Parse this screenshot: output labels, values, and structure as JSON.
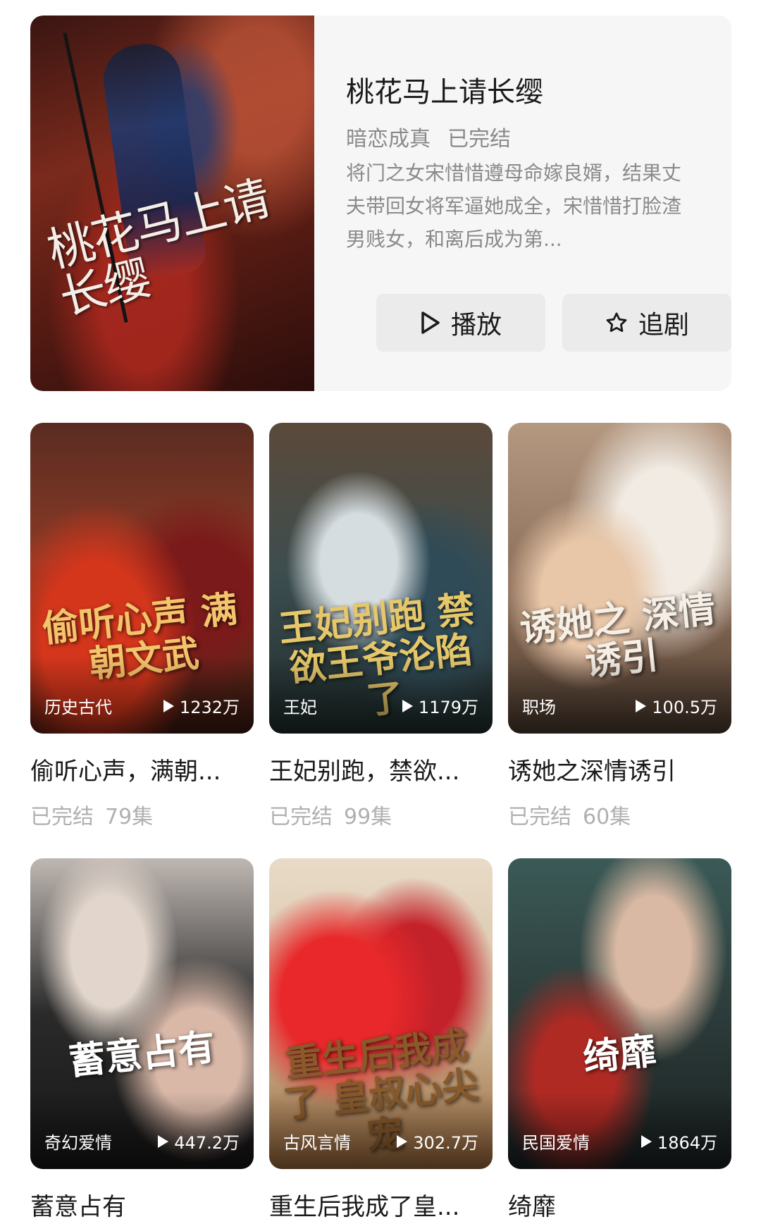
{
  "featured": {
    "poster_text": "桃花马上请长缨",
    "title": "桃花马上请长缨",
    "tag": "暗恋成真",
    "status": "已完结",
    "description": "将门之女宋惜惜遵母命嫁良婿，结果丈夫带回女将军逼她成全，宋惜惜打脸渣男贱女，和离后成为第...",
    "play_label": "播放",
    "follow_label": "追剧"
  },
  "cards": [
    {
      "poster_title": "偷听心声 满朝文武",
      "poster_color": "#f3c46b",
      "tag": "历史古代",
      "plays": "1232万",
      "title": "偷听心声，满朝...",
      "status": "已完结",
      "episodes": "79集"
    },
    {
      "poster_title": "王妃别跑 禁欲王爷沦陷了",
      "poster_color": "#e6c86a",
      "tag": "王妃",
      "plays": "1179万",
      "title": "王妃别跑，禁欲...",
      "status": "已完结",
      "episodes": "99集"
    },
    {
      "poster_title": "诱她之 深情诱引",
      "poster_color": "#f6efe6",
      "tag": "职场",
      "plays": "100.5万",
      "title": "诱她之深情诱引",
      "status": "已完结",
      "episodes": "60集"
    },
    {
      "poster_title": "蓄意占有",
      "poster_color": "#ffffff",
      "tag": "奇幻爱情",
      "plays": "447.2万",
      "title": "蓄意占有",
      "status": "",
      "episodes": ""
    },
    {
      "poster_title": "重生后我成了 皇叔心尖宠",
      "poster_color": "#8a5a2a",
      "tag": "古风言情",
      "plays": "302.7万",
      "title": "重生后我成了皇...",
      "status": "",
      "episodes": ""
    },
    {
      "poster_title": "绮靡",
      "poster_color": "#ffffff",
      "tag": "民国爱情",
      "plays": "1864万",
      "title": "绮靡",
      "status": "",
      "episodes": ""
    }
  ]
}
